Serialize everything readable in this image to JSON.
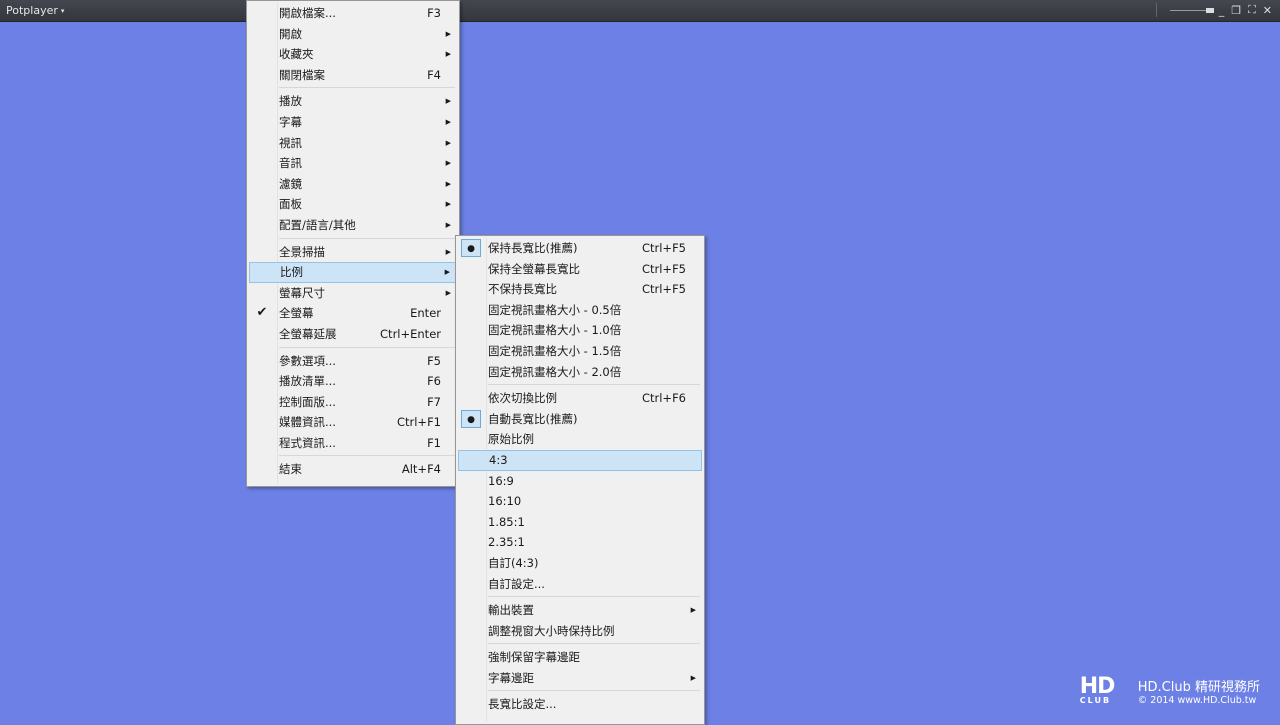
{
  "titlebar": {
    "title": "Potplayer",
    "caret": "▾",
    "minimize": "_",
    "restore": "❐",
    "fullscreen": "⛶",
    "close": "✕"
  },
  "main_menu": [
    {
      "label": "開啟檔案...",
      "shortcut": "F3"
    },
    {
      "label": "開啟",
      "submenu": true
    },
    {
      "label": "收藏夾",
      "submenu": true
    },
    {
      "label": "關閉檔案",
      "shortcut": "F4"
    },
    {
      "separator": true
    },
    {
      "label": "播放",
      "submenu": true
    },
    {
      "label": "字幕",
      "submenu": true
    },
    {
      "label": "視訊",
      "submenu": true
    },
    {
      "label": "音訊",
      "submenu": true
    },
    {
      "label": "濾鏡",
      "submenu": true
    },
    {
      "label": "面板",
      "submenu": true
    },
    {
      "label": "配置/語言/其他",
      "submenu": true
    },
    {
      "separator": true
    },
    {
      "label": "全景掃描",
      "submenu": true
    },
    {
      "label": "比例",
      "submenu": true,
      "highlighted": true
    },
    {
      "label": "螢幕尺寸",
      "submenu": true
    },
    {
      "label": "全螢幕",
      "shortcut": "Enter",
      "checked": "check"
    },
    {
      "label": "全螢幕延展",
      "shortcut": "Ctrl+Enter"
    },
    {
      "separator": true
    },
    {
      "label": "參數選項...",
      "shortcut": "F5"
    },
    {
      "label": "播放清單...",
      "shortcut": "F6"
    },
    {
      "label": "控制面版...",
      "shortcut": "F7"
    },
    {
      "label": "媒體資訊...",
      "shortcut": "Ctrl+F1"
    },
    {
      "label": "程式資訊...",
      "shortcut": "F1"
    },
    {
      "separator": true
    },
    {
      "label": "結束",
      "shortcut": "Alt+F4"
    }
  ],
  "sub_menu": [
    {
      "label": "保持長寬比(推薦)",
      "shortcut": "Ctrl+F5",
      "checked": "radio"
    },
    {
      "label": "保持全螢幕長寬比",
      "shortcut": "Ctrl+F5"
    },
    {
      "label": "不保持長寬比",
      "shortcut": "Ctrl+F5"
    },
    {
      "label": "固定視訊畫格大小 - 0.5倍"
    },
    {
      "label": "固定視訊畫格大小 - 1.0倍"
    },
    {
      "label": "固定視訊畫格大小 - 1.5倍"
    },
    {
      "label": "固定視訊畫格大小 - 2.0倍"
    },
    {
      "separator": true
    },
    {
      "label": "依次切換比例",
      "shortcut": "Ctrl+F6"
    },
    {
      "label": "自動長寬比(推薦)",
      "checked": "radio"
    },
    {
      "label": "原始比例"
    },
    {
      "label": "4:3",
      "highlighted": true
    },
    {
      "label": "16:9"
    },
    {
      "label": "16:10"
    },
    {
      "label": "1.85:1"
    },
    {
      "label": "2.35:1"
    },
    {
      "label": "自訂(4:3)"
    },
    {
      "label": "自訂設定..."
    },
    {
      "separator": true
    },
    {
      "label": "輸出裝置",
      "submenu": true
    },
    {
      "label": "調整視窗大小時保持比例"
    },
    {
      "separator": true
    },
    {
      "label": "強制保留字幕邊距"
    },
    {
      "label": "字幕邊距",
      "submenu": true
    },
    {
      "separator": true
    },
    {
      "label": "長寬比設定..."
    }
  ],
  "logo": {
    "mark": "HD",
    "mark_sub": "CLUB",
    "line1": "HD.Club 精研視務所",
    "line2": "© 2014  www.HD.Club.tw"
  },
  "colors": {
    "background": "#6c80e5",
    "highlight": "#cde4f7"
  }
}
